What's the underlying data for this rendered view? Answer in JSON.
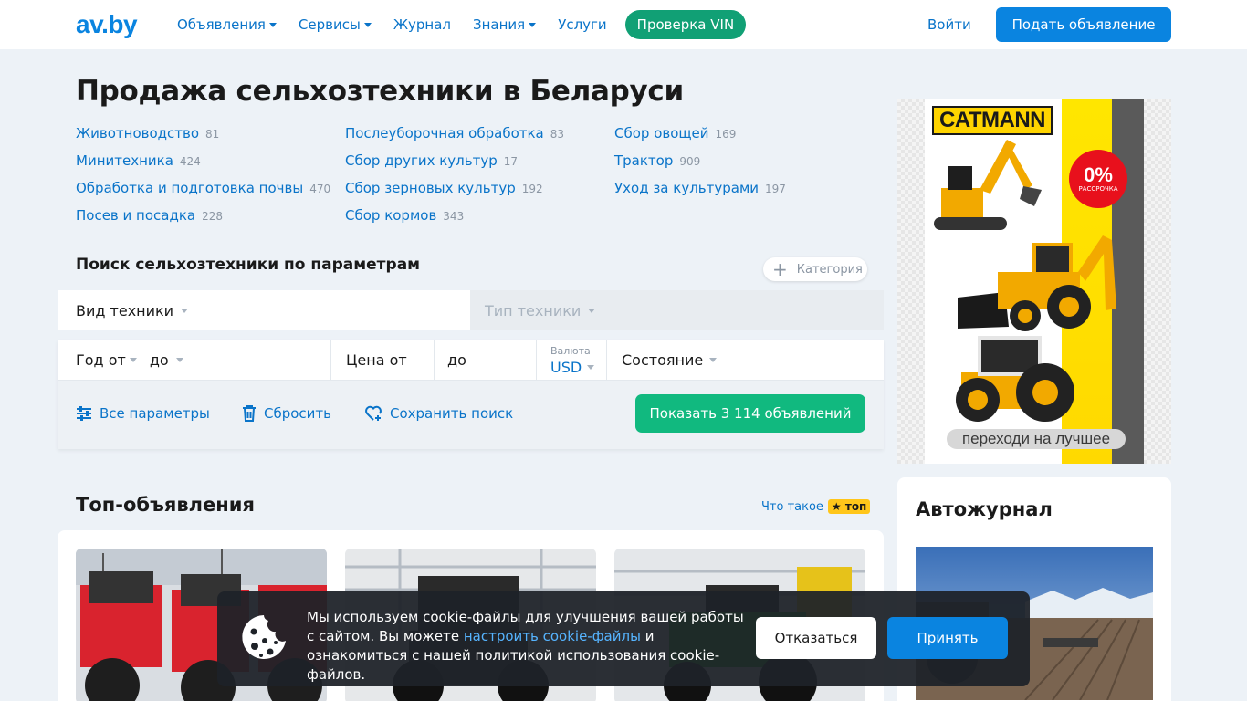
{
  "header": {
    "logo": "av.by",
    "nav": [
      {
        "label": "Объявления",
        "dropdown": true
      },
      {
        "label": "Сервисы",
        "dropdown": true
      },
      {
        "label": "Журнал",
        "dropdown": false
      },
      {
        "label": "Знания",
        "dropdown": true
      },
      {
        "label": "Услуги",
        "dropdown": false
      }
    ],
    "vin_button": "Проверка VIN",
    "login": "Войти",
    "post_button": "Подать объявление"
  },
  "page_title": "Продажа сельхозтехники в Беларуси",
  "categories": [
    [
      {
        "label": "Животноводство",
        "count": "81"
      },
      {
        "label": "Минитехника",
        "count": "424"
      },
      {
        "label": "Обработка и подготовка почвы",
        "count": "470"
      },
      {
        "label": "Посев и посадка",
        "count": "228"
      }
    ],
    [
      {
        "label": "Послеуборочная обработка",
        "count": "83"
      },
      {
        "label": "Сбор других культур",
        "count": "17"
      },
      {
        "label": "Сбор зерновых культур",
        "count": "192"
      },
      {
        "label": "Сбор кормов",
        "count": "343"
      }
    ],
    [
      {
        "label": "Сбор овощей",
        "count": "169"
      },
      {
        "label": "Трактор",
        "count": "909"
      },
      {
        "label": "Уход за культурами",
        "count": "197"
      }
    ]
  ],
  "search": {
    "title": "Поиск сельхозтехники по параметрам",
    "category_chip": "Категория",
    "vehicle_kind": "Вид техники",
    "vehicle_type": "Тип техники",
    "year_from": "Год от",
    "year_to": "до",
    "price_from": "Цена от",
    "price_to": "до",
    "currency_label": "Валюта",
    "currency_value": "USD",
    "condition": "Состояние",
    "all_params": "Все параметры",
    "reset": "Сбросить",
    "save_search": "Сохранить поиск",
    "show_button": "Показать 3 114 объявлений"
  },
  "ad": {
    "brand": "CATMANN",
    "badge_percent": "0%",
    "badge_text": "РАССРОЧКА",
    "caption": "переходи на лучшее"
  },
  "top_listings": {
    "title": "Топ-объявления",
    "what_is": "Что такое",
    "badge": "★ топ"
  },
  "journal": {
    "title": "Автожурнал"
  },
  "cookie": {
    "text_before": "Мы используем cookie-файлы для улучшения вашей работы с сайтом. Вы можете ",
    "link": "настроить cookie-файлы",
    "text_after": " и ознакомиться с нашей политикой использования cookie-файлов.",
    "refuse": "Отказаться",
    "accept": "Принять"
  },
  "colors": {
    "brand_blue": "#0a84e0",
    "link_blue": "#0a74c9",
    "green": "#11b97f",
    "background": "#edf2f7"
  }
}
